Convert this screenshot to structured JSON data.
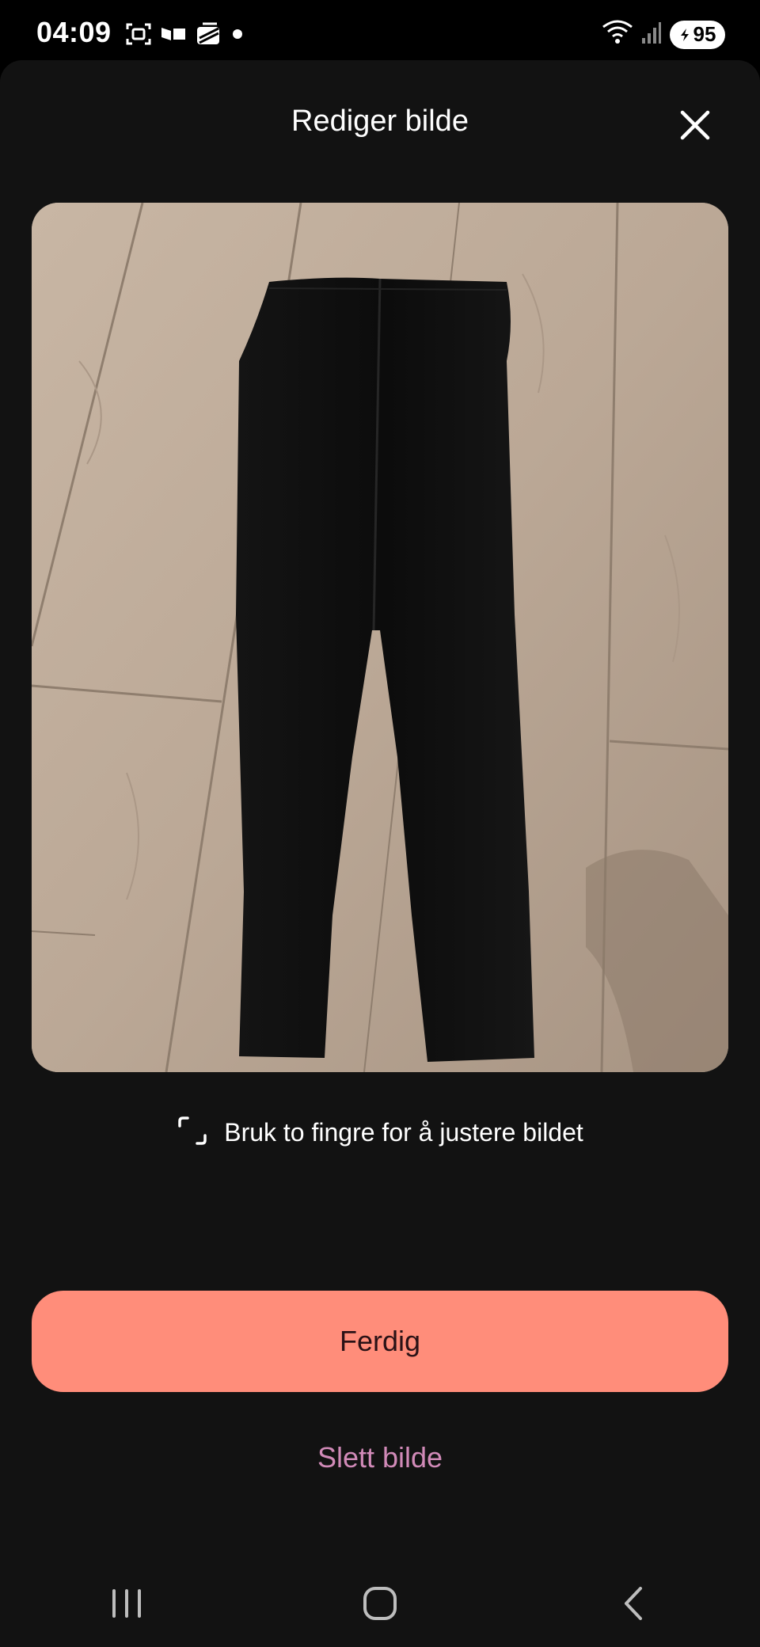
{
  "status_bar": {
    "time": "04:09",
    "battery_level": "95",
    "icons": [
      "screenshot-icon",
      "media-icon",
      "layers-app-icon",
      "notification-dot-icon",
      "wifi-icon",
      "signal-icon",
      "battery-icon"
    ]
  },
  "sheet": {
    "title": "Rediger bilde",
    "close_icon": "close-icon"
  },
  "photo": {
    "subject": "black trousers on wooden floor",
    "floor_color": "#bdaa9a",
    "garment_color": "#0d0d0d"
  },
  "hint": {
    "icon": "crop-icon",
    "text": "Bruk to fingre for å justere bildet"
  },
  "actions": {
    "done_label": "Ferdig",
    "delete_label": "Slett bilde"
  },
  "colors": {
    "background": "#121212",
    "accent": "#ff8d7a",
    "accent_text": "#2a1216",
    "delete_text": "#d18ab8"
  },
  "navigation": {
    "recents_icon": "recents-icon",
    "home_icon": "home-icon",
    "back_icon": "back-icon"
  }
}
